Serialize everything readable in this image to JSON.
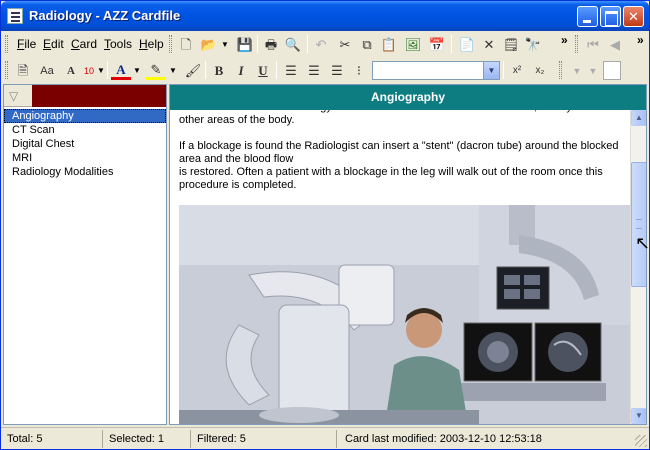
{
  "window": {
    "title": "Radiology - AZZ Cardfile"
  },
  "menu": {
    "items": [
      {
        "label": "File",
        "key": "F",
        "rest": "ile"
      },
      {
        "label": "Edit",
        "key": "E",
        "rest": "dit"
      },
      {
        "label": "Card",
        "key": "C",
        "rest": "ard"
      },
      {
        "label": "Tools",
        "key": "T",
        "rest": "ools"
      },
      {
        "label": "Help",
        "key": "H",
        "rest": "elp"
      }
    ]
  },
  "toolbar": {
    "font_size": "10",
    "bold": "B",
    "italic": "I",
    "underline": "U",
    "superscript": "x²",
    "subscript": "x₂",
    "style_value": "",
    "more": "»"
  },
  "cards": {
    "items": [
      {
        "label": "Angiography",
        "selected": true
      },
      {
        "label": "CT Scan",
        "selected": false
      },
      {
        "label": "Digital Chest",
        "selected": false
      },
      {
        "label": "MRI",
        "selected": false
      },
      {
        "label": "Radiology Modalities",
        "selected": false
      }
    ]
  },
  "card": {
    "title": "Angiography",
    "paragraph_top": "This is Interventional Radiology. It is also used in areas such as the heart, kidneys and other areas of the body.",
    "paragraph_1": "If a blockage is found the Radiologist can insert a \"stent\" (dacron tube) around the blocked area and the blood flow",
    "paragraph_2": "is restored.  Often a patient with a blockage in the leg will walk out of the room once this procedure is completed."
  },
  "status": {
    "total": "Total: 5",
    "selected": "Selected: 1",
    "filtered": "Filtered: 5",
    "modified": "Card last modified: 2003-12-10  12:53:18"
  },
  "colors": {
    "title_bar": "#0054e3",
    "card_header": "#0e7d82",
    "filter_bar": "#7a0000",
    "selection": "#316ac5"
  }
}
